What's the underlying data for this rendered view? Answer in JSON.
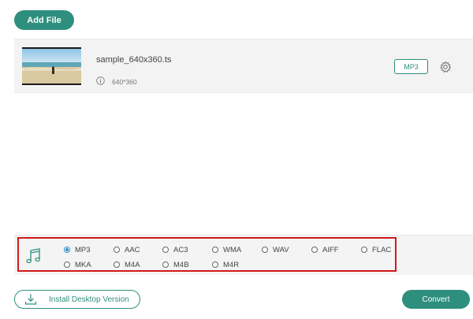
{
  "toolbar": {
    "add_file_label": "Add File"
  },
  "file": {
    "name": "sample_640x360.ts",
    "resolution": "640*360",
    "output_format": "MP3"
  },
  "icons": {
    "info": "info-icon",
    "settings": "gear-icon",
    "music": "music-note-icon",
    "download": "download-icon"
  },
  "formats": {
    "selected": "MP3",
    "options": [
      "MP3",
      "AAC",
      "AC3",
      "WMA",
      "WAV",
      "AIFF",
      "FLAC",
      "MKA",
      "M4A",
      "M4B",
      "M4R"
    ]
  },
  "footer": {
    "install_label": "Install Desktop Version",
    "convert_label": "Convert"
  },
  "colors": {
    "accent": "#2f8f7e",
    "highlight_border": "#d11a1a",
    "radio_selected": "#2f8fc9"
  }
}
